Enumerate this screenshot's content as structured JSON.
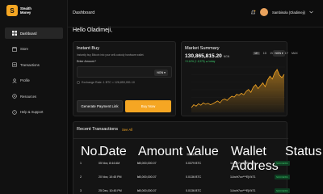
{
  "brand": {
    "name_line1": "Stealth",
    "name_line2": "Money"
  },
  "sidebar": {
    "items": [
      {
        "label": "Dashboard",
        "icon": "grid-icon"
      },
      {
        "label": "Store",
        "icon": "store-icon"
      },
      {
        "label": "Transactions",
        "icon": "transactions-icon"
      },
      {
        "label": "Profile",
        "icon": "user-icon"
      },
      {
        "label": "Resources",
        "icon": "resources-icon"
      },
      {
        "label": "Help & Support",
        "icon": "help-icon"
      }
    ]
  },
  "header": {
    "title": "Dashboard",
    "user_name": "Sambisola (Oladimeji)"
  },
  "greeting": "Hello Oladimeji,",
  "instant_buy": {
    "title": "Instant Buy",
    "subtitle": "Instantly buy Bitcoin into your self-custody hardware wallet.",
    "amount_label": "Enter Amount *",
    "currency": "NGN",
    "rate": "Exchange Rate: 1 BTC = 126,853,051.10",
    "generate_label": "Generate Payment Link",
    "buy_label": "Buy Now"
  },
  "market": {
    "title": "Market Summary",
    "price": "130,865,815.20",
    "currency": "NGN",
    "change": "+0.14% (+ 4,975) ▲ today",
    "ranges": [
      "1H",
      "1D",
      "1W",
      "1M",
      "1Y",
      "MAX"
    ],
    "active_range": "1H",
    "currency_select": "NGN"
  },
  "chart_data": {
    "type": "area",
    "x": [
      0,
      1,
      2,
      3,
      4,
      5,
      6,
      7,
      8,
      9,
      10,
      11,
      12,
      13,
      14,
      15,
      16,
      17,
      18,
      19,
      20,
      21,
      22,
      23,
      24,
      25,
      26,
      27,
      28,
      29,
      30,
      31,
      32,
      33,
      34,
      35,
      36,
      37,
      38,
      39
    ],
    "values": [
      52,
      58,
      55,
      60,
      57,
      62,
      59,
      61,
      58,
      60,
      63,
      66,
      62,
      68,
      70,
      67,
      72,
      76,
      74,
      80,
      78,
      82,
      79,
      86,
      90,
      84,
      95,
      100,
      92,
      98,
      104,
      96,
      110,
      118,
      112,
      125,
      132,
      120,
      115,
      122
    ],
    "accent": "#f5a623"
  },
  "transactions": {
    "title": "Recent Transactions",
    "see_all": "See All",
    "columns": [
      "No.",
      "Date",
      "Amount",
      "Value",
      "Wallet Address",
      "Status"
    ],
    "amount_currency": "NGN",
    "rows": [
      {
        "no": "1",
        "date": "05 Nov, 8:44 AM",
        "amount": "₦5,000,000.07",
        "value": "0.0379 BTC",
        "wallet": "1Lbcfr7ov***EjVkT1",
        "status": "SUCCESS"
      },
      {
        "no": "2",
        "date": "20 Nov, 10:45 PM",
        "amount": "₦5,000,000.07",
        "value": "0.0136 BTC",
        "wallet": "1Lbcfr7ov***EjVkT1",
        "status": "SUCCESS"
      },
      {
        "no": "3",
        "date": "25 Dec, 10:45 PM",
        "amount": "₦5,000,000.07",
        "value": "0.0136 BTC",
        "wallet": "1Lbcfr7ov***EjVkT1",
        "status": "SUCCESS"
      }
    ]
  }
}
